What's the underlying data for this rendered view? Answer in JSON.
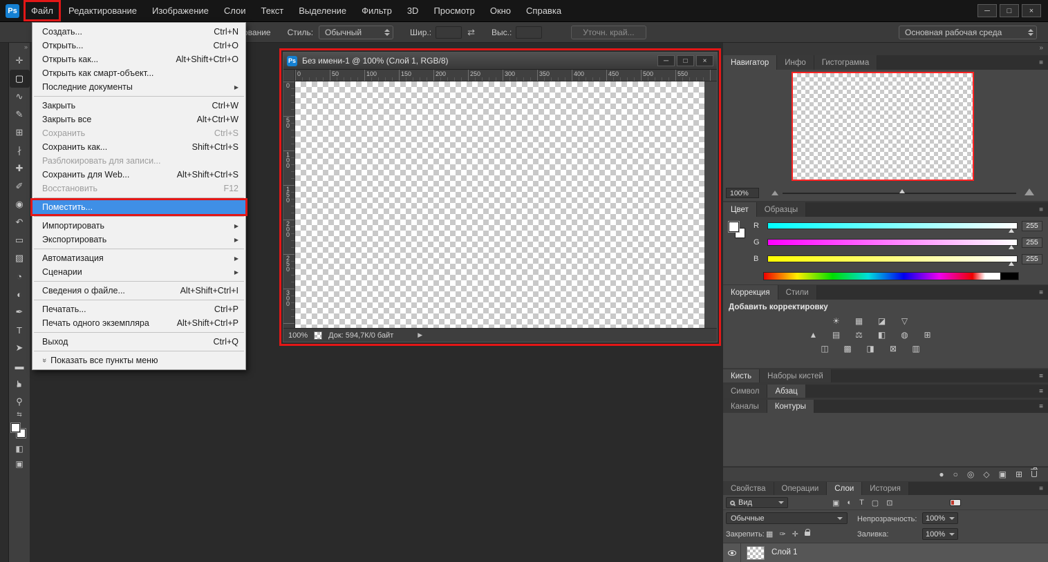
{
  "colors": {
    "annotation": "#e31717",
    "menu_highlight": "#3f8fe6",
    "navigator_view": "#ff2222",
    "logo": "#1580d2"
  },
  "icons": {
    "collapse": "»",
    "panel_menu": "≡",
    "submenu_arrow": "▶",
    "status_arrow": "▶",
    "swap": "⇄",
    "mini_swap": "⇆",
    "quick_mask": "◧",
    "screen_mode": "▣",
    "show_all": "»"
  },
  "window_controls": [
    {
      "key": "minimize",
      "glyph": "─"
    },
    {
      "key": "maximize",
      "glyph": "□"
    },
    {
      "key": "close",
      "glyph": "×"
    }
  ],
  "menubar": {
    "logo": "Ps",
    "items": [
      {
        "key": "file",
        "label": "Файл",
        "annotated": true
      },
      {
        "key": "edit",
        "label": "Редактирование"
      },
      {
        "key": "image",
        "label": "Изображение"
      },
      {
        "key": "layers",
        "label": "Слои"
      },
      {
        "key": "type",
        "label": "Текст"
      },
      {
        "key": "select",
        "label": "Выделение"
      },
      {
        "key": "filter",
        "label": "Фильтр"
      },
      {
        "key": "3d",
        "label": "3D"
      },
      {
        "key": "view",
        "label": "Просмотр"
      },
      {
        "key": "window",
        "label": "Окно"
      },
      {
        "key": "help",
        "label": "Справка"
      }
    ]
  },
  "options_bar": {
    "clipped_label": "ование",
    "style_label": "Стиль:",
    "style_value": "Обычный",
    "width_label": "Шир.:",
    "height_label": "Выс.:",
    "refine_edge_label": "Уточн. край...",
    "workspace_label": "Основная рабочая среда"
  },
  "file_menu": {
    "items": [
      {
        "key": "new",
        "label": "Создать...",
        "shortcut": "Ctrl+N"
      },
      {
        "key": "open",
        "label": "Открыть...",
        "shortcut": "Ctrl+O"
      },
      {
        "key": "open-as",
        "label": "Открыть как...",
        "shortcut": "Alt+Shift+Ctrl+O"
      },
      {
        "key": "open-as-smart-object",
        "label": "Открыть как смарт-объект..."
      },
      {
        "key": "recent-files",
        "label": "Последние документы",
        "submenu": true
      },
      {
        "sep": true
      },
      {
        "key": "close",
        "label": "Закрыть",
        "shortcut": "Ctrl+W"
      },
      {
        "key": "close-all",
        "label": "Закрыть все",
        "shortcut": "Alt+Ctrl+W"
      },
      {
        "key": "save",
        "label": "Сохранить",
        "shortcut": "Ctrl+S",
        "disabled": true
      },
      {
        "key": "save-as",
        "label": "Сохранить как...",
        "shortcut": "Shift+Ctrl+S"
      },
      {
        "key": "unlock-for-writing",
        "label": "Разблокировать для записи...",
        "disabled": true
      },
      {
        "key": "save-for-web",
        "label": "Сохранить для Web...",
        "shortcut": "Alt+Shift+Ctrl+S"
      },
      {
        "key": "revert",
        "label": "Восстановить",
        "shortcut": "F12",
        "disabled": true
      },
      {
        "sep": true
      },
      {
        "key": "place",
        "label": "Поместить...",
        "highlighted": true,
        "annotated": true
      },
      {
        "sep": true
      },
      {
        "key": "import",
        "label": "Импортировать",
        "submenu": true
      },
      {
        "key": "export",
        "label": "Экспортировать",
        "submenu": true
      },
      {
        "sep": true
      },
      {
        "key": "automate",
        "label": "Автоматизация",
        "submenu": true
      },
      {
        "key": "scripts",
        "label": "Сценарии",
        "submenu": true
      },
      {
        "sep": true
      },
      {
        "key": "file-info",
        "label": "Сведения о файле...",
        "shortcut": "Alt+Shift+Ctrl+I"
      },
      {
        "sep": true
      },
      {
        "key": "print",
        "label": "Печатать...",
        "shortcut": "Ctrl+P"
      },
      {
        "key": "print-one-copy",
        "label": "Печать одного экземпляра",
        "shortcut": "Alt+Shift+Ctrl+P"
      },
      {
        "sep": true
      },
      {
        "key": "exit",
        "label": "Выход",
        "shortcut": "Ctrl+Q"
      },
      {
        "sep": true
      },
      {
        "key": "show-all-menu-items",
        "label": "Показать все пункты меню",
        "icon": "show_all"
      }
    ]
  },
  "toolbar": {
    "tools": [
      {
        "name": "move-tool",
        "glyph": "✛"
      },
      {
        "name": "rectangular-marquee-tool",
        "glyph": "▢",
        "selected": true
      },
      {
        "name": "lasso-tool",
        "glyph": "∿"
      },
      {
        "name": "quick-selection-tool",
        "glyph": "✎"
      },
      {
        "name": "crop-tool",
        "glyph": "⊞"
      },
      {
        "name": "eyedropper-tool",
        "glyph": "∤"
      },
      {
        "name": "healing-brush-tool",
        "glyph": "✚"
      },
      {
        "name": "brush-tool",
        "glyph": "✐"
      },
      {
        "name": "clone-stamp-tool",
        "glyph": "◉"
      },
      {
        "name": "history-brush-tool",
        "glyph": "↶"
      },
      {
        "name": "eraser-tool",
        "glyph": "▭"
      },
      {
        "name": "gradient-tool",
        "glyph": "▨"
      },
      {
        "name": "blur-tool",
        "glyph": "◔"
      },
      {
        "name": "dodge-tool",
        "glyph": "◐"
      },
      {
        "name": "pen-tool",
        "glyph": "✒"
      },
      {
        "name": "type-tool",
        "glyph": "T"
      },
      {
        "name": "path-selection-tool",
        "glyph": "➤"
      },
      {
        "name": "shape-tool",
        "glyph": "▬"
      },
      {
        "name": "hand-tool",
        "glyph": "☛"
      },
      {
        "name": "zoom-tool",
        "glyph": "⚲"
      }
    ]
  },
  "document_window": {
    "icon": "Ps",
    "title": "Без имени-1 @ 100% (Слой 1, RGB/8)",
    "h_ruler": [
      "0",
      "50",
      "100",
      "150",
      "200",
      "250",
      "300",
      "350",
      "400",
      "450",
      "500",
      "550"
    ],
    "v_ruler": [
      "0",
      "50",
      "100",
      "150",
      "200",
      "250",
      "300"
    ],
    "zoom": "100%",
    "doc_info": "Док: 594,7К/0 байт"
  },
  "panels": {
    "navigator": {
      "tabs": [
        {
          "key": "navigator",
          "label": "Навигатор",
          "active": true
        },
        {
          "key": "info",
          "label": "Инфо"
        },
        {
          "key": "histogram",
          "label": "Гистограмма"
        }
      ],
      "zoom": "100%"
    },
    "color": {
      "tabs": [
        {
          "key": "color",
          "label": "Цвет",
          "active": true
        },
        {
          "key": "swatches",
          "label": "Образцы"
        }
      ],
      "channels": [
        {
          "key": "r",
          "label": "R",
          "value": "255"
        },
        {
          "key": "g",
          "label": "G",
          "value": "255"
        },
        {
          "key": "b",
          "label": "B",
          "value": "255"
        }
      ]
    },
    "adjustments": {
      "tabs": [
        {
          "key": "adjustments",
          "label": "Коррекция",
          "active": true
        },
        {
          "key": "styles",
          "label": "Стили"
        }
      ],
      "title": "Добавить корректировку",
      "icon_rows": [
        [
          {
            "name": "brightness-contrast",
            "glyph": "☀"
          },
          {
            "name": "levels",
            "glyph": "▦"
          },
          {
            "name": "curves",
            "glyph": "◪"
          },
          {
            "name": "exposure",
            "glyph": "▽"
          }
        ],
        [
          {
            "name": "vibrance",
            "glyph": "▲"
          },
          {
            "name": "hue-saturation",
            "glyph": "▤"
          },
          {
            "name": "color-balance",
            "glyph": "⚖"
          },
          {
            "name": "black-white",
            "glyph": "◧"
          },
          {
            "name": "photo-filter",
            "glyph": "◍"
          },
          {
            "name": "channel-mixer",
            "glyph": "⊞"
          }
        ],
        [
          {
            "name": "invert",
            "glyph": "◫"
          },
          {
            "name": "posterize",
            "glyph": "▩"
          },
          {
            "name": "threshold",
            "glyph": "◨"
          },
          {
            "name": "gradient-map",
            "glyph": "⊠"
          },
          {
            "name": "selective-color",
            "glyph": "▥"
          }
        ]
      ]
    },
    "brush": {
      "tabs": [
        {
          "key": "brush",
          "label": "Кисть",
          "active": true
        },
        {
          "key": "brush-presets",
          "label": "Наборы кистей"
        }
      ]
    },
    "character": {
      "tabs": [
        {
          "key": "character",
          "label": "Символ"
        },
        {
          "key": "paragraph",
          "label": "Абзац",
          "active": true
        }
      ]
    },
    "channels_panel": {
      "tabs": [
        {
          "key": "channels",
          "label": "Каналы"
        },
        {
          "key": "paths",
          "label": "Контуры",
          "active": true
        }
      ]
    },
    "paths_footer": [
      {
        "name": "fill-path-icon",
        "glyph": "●"
      },
      {
        "name": "stroke-path-icon",
        "glyph": "○"
      },
      {
        "name": "load-path-selection-icon",
        "glyph": "◎"
      },
      {
        "name": "make-work-path-icon",
        "glyph": "◇"
      },
      {
        "name": "add-mask-icon",
        "glyph": "▣"
      },
      {
        "name": "new-path-icon",
        "glyph": "⊞"
      },
      {
        "name": "delete-icon",
        "shape": "trash"
      }
    ],
    "layers": {
      "tabs": [
        {
          "key": "properties",
          "label": "Свойства"
        },
        {
          "key": "actions",
          "label": "Операции"
        },
        {
          "key": "layers",
          "label": "Слои",
          "active": true
        },
        {
          "key": "history",
          "label": "История"
        }
      ],
      "view_label": "Вид",
      "filter_icons": [
        {
          "name": "filter-pixel-layers-icon",
          "glyph": "▣"
        },
        {
          "name": "filter-adjustment-layers-icon",
          "glyph": "◐"
        },
        {
          "name": "filter-type-layers-icon",
          "glyph": "T"
        },
        {
          "name": "filter-shape-layers-icon",
          "glyph": "▢"
        },
        {
          "name": "filter-smart-objects-icon",
          "glyph": "⊡"
        }
      ],
      "blend_mode": "Обычные",
      "opacity_label": "Непрозрачность:",
      "opacity_value": "100%",
      "lock_label": "Закрепить:",
      "lock_icons": [
        {
          "name": "lock-transparency-icon",
          "glyph": "▦"
        },
        {
          "name": "lock-pixels-icon",
          "glyph": "✑"
        },
        {
          "name": "lock-position-icon",
          "glyph": "✛"
        },
        {
          "name": "lock-all-icon",
          "shape": "lock"
        }
      ],
      "fill_label": "Заливка:",
      "fill_value": "100%",
      "layer_name": "Слой 1"
    }
  }
}
